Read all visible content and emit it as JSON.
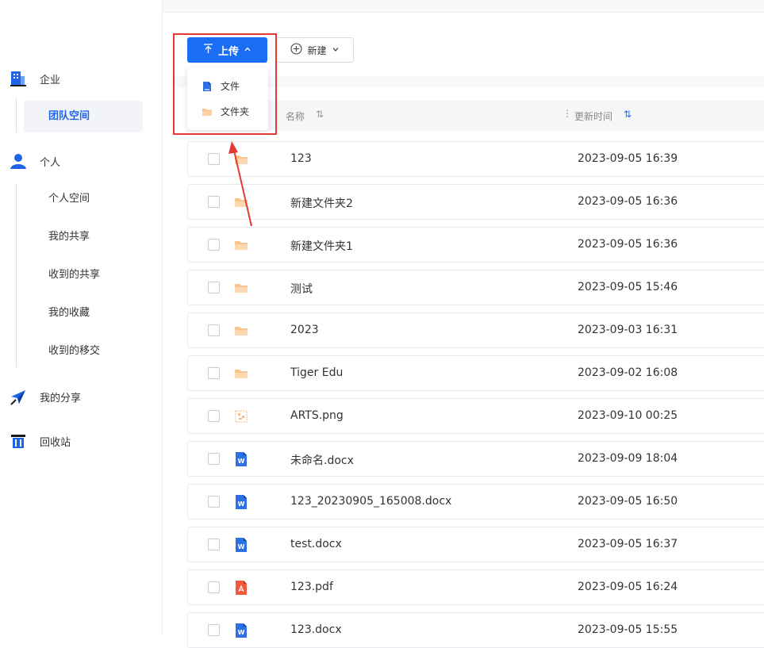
{
  "sidebar": {
    "enterprise": {
      "label": "企业",
      "icon": "building-icon"
    },
    "team_space": "团队空间",
    "personal": {
      "label": "个人",
      "icon": "user-icon"
    },
    "personal_items": [
      "个人空间",
      "我的共享",
      "收到的共享",
      "我的收藏",
      "收到的移交"
    ],
    "my_shares": {
      "label": "我的分享",
      "icon": "send-icon"
    },
    "recycle": {
      "label": "回收站",
      "icon": "trash-icon"
    }
  },
  "toolbar": {
    "upload_label": "上传",
    "upload_icon": "upload-icon",
    "new_label": "新建",
    "new_icon": "plus-circle-icon"
  },
  "upload_menu": {
    "items": [
      {
        "label": "文件",
        "icon": "file-icon"
      },
      {
        "label": "文件夹",
        "icon": "folder-icon"
      }
    ]
  },
  "table": {
    "col_name": "名称",
    "col_time": "更新时间",
    "sort_icon": "⇅",
    "rows": [
      {
        "name": "123",
        "time": "2023-09-05 16:39",
        "type": "folder"
      },
      {
        "name": "新建文件夹2",
        "time": "2023-09-05 16:36",
        "type": "folder"
      },
      {
        "name": "新建文件夹1",
        "time": "2023-09-05 16:36",
        "type": "folder"
      },
      {
        "name": "测试",
        "time": "2023-09-05 15:46",
        "type": "folder"
      },
      {
        "name": "2023",
        "time": "2023-09-03 16:31",
        "type": "folder"
      },
      {
        "name": "Tiger Edu",
        "time": "2023-09-02 16:08",
        "type": "folder"
      },
      {
        "name": "ARTS.png",
        "time": "2023-09-10 00:25",
        "type": "image"
      },
      {
        "name": "未命名.docx",
        "time": "2023-09-09 18:04",
        "type": "word"
      },
      {
        "name": "123_20230905_165008.docx",
        "time": "2023-09-05 16:50",
        "type": "word"
      },
      {
        "name": "test.docx",
        "time": "2023-09-05 16:37",
        "type": "word"
      },
      {
        "name": "123.pdf",
        "time": "2023-09-05 16:24",
        "type": "pdf"
      },
      {
        "name": "123.docx",
        "time": "2023-09-05 15:55",
        "type": "word"
      }
    ]
  },
  "colors": {
    "accent": "#1a6ef5",
    "folder": "#f9c48d",
    "highlight": "#e53935"
  }
}
